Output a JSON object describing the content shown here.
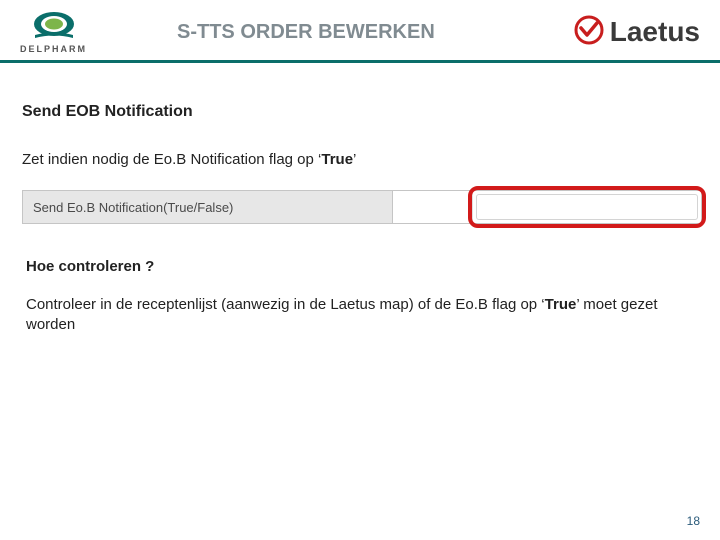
{
  "header": {
    "left_logo_text": "DELPHARM",
    "title": "S-TTS ORDER BEWERKEN",
    "right_logo_text": "Laetus"
  },
  "section": {
    "heading": "Send EOB Notification",
    "instruction_prefix": "Zet indien nodig de Eo.B Notification flag op ‘",
    "instruction_bold": "True",
    "instruction_suffix": "’"
  },
  "field": {
    "label": "Send Eo.B Notification(True/False)",
    "value": "",
    "placeholder": ""
  },
  "check": {
    "heading": "Hoe controleren ?",
    "body_prefix": "Controleer in de receptenlijst (aanwezig in de Laetus map) of de Eo.B flag op ‘",
    "body_bold": "True",
    "body_suffix": "’ moet gezet worden"
  },
  "page_number": "18"
}
